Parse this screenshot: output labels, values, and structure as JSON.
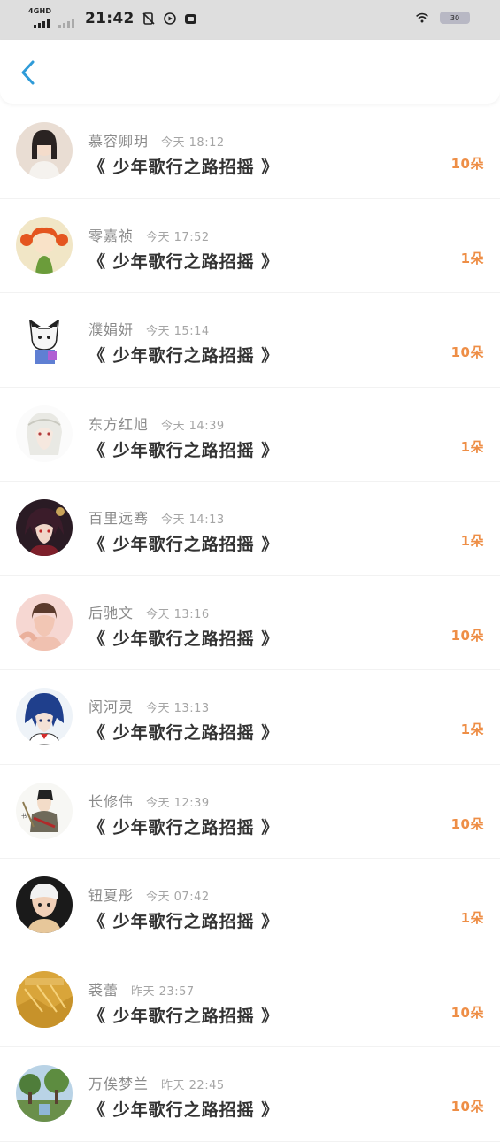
{
  "status_bar": {
    "network": "4GHD",
    "time": "21:42",
    "battery": "30"
  },
  "header": {
    "back_icon": "chevron-left-icon",
    "accent_color": "#2f9bd8"
  },
  "gift_color": "#ee8e46",
  "records": [
    {
      "name": "慕容卿玥",
      "time": "今天 18:12",
      "title": "《 少年歌行之路招摇 》",
      "amount": "10朵"
    },
    {
      "name": "零嘉祯",
      "time": "今天 17:52",
      "title": "《 少年歌行之路招摇 》",
      "amount": "1朵"
    },
    {
      "name": "濮娟妍",
      "time": "今天 15:14",
      "title": "《 少年歌行之路招摇 》",
      "amount": "10朵"
    },
    {
      "name": "东方红旭",
      "time": "今天 14:39",
      "title": "《 少年歌行之路招摇 》",
      "amount": "1朵"
    },
    {
      "name": "百里远骞",
      "time": "今天 14:13",
      "title": "《 少年歌行之路招摇 》",
      "amount": "1朵"
    },
    {
      "name": "后驰文",
      "time": "今天 13:16",
      "title": "《 少年歌行之路招摇 》",
      "amount": "10朵"
    },
    {
      "name": "闵河灵",
      "time": "今天 13:13",
      "title": "《 少年歌行之路招摇 》",
      "amount": "1朵"
    },
    {
      "name": "长修伟",
      "time": "今天 12:39",
      "title": "《 少年歌行之路招摇 》",
      "amount": "10朵"
    },
    {
      "name": "钮夏彤",
      "time": "今天 07:42",
      "title": "《 少年歌行之路招摇 》",
      "amount": "1朵"
    },
    {
      "name": "裘蕾",
      "time": "昨天 23:57",
      "title": "《 少年歌行之路招摇 》",
      "amount": "10朵"
    },
    {
      "name": "万俟梦兰",
      "time": "昨天 22:45",
      "title": "《 少年歌行之路招摇 》",
      "amount": "10朵"
    }
  ]
}
